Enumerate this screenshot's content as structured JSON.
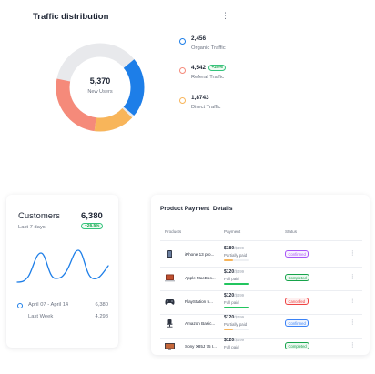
{
  "traffic": {
    "title": "Traffic distribution",
    "menu_icon": "kebab-vertical-icon",
    "total": "5,370",
    "total_label": "New Users",
    "legend": [
      {
        "value": "2,456",
        "badge": "",
        "label": "Organic Traffic",
        "color": "#1d7ee8"
      },
      {
        "value": "4,542",
        "badge": "+25%",
        "label": "Referal Traffic",
        "color": "#f58a7a"
      },
      {
        "value": "1,8743",
        "badge": "",
        "label": "Direct Traffic",
        "color": "#f8b55a"
      }
    ],
    "colors": {
      "organic": "#1d7ee8",
      "referral": "#f58a7a",
      "direct": "#f8b55a",
      "rest": "#e8e9ec"
    }
  },
  "customers": {
    "title": "Customers",
    "total": "6,380",
    "period": "Last 7 days",
    "badge": "+26.5%",
    "rows": [
      {
        "label": "April 07 - April 14",
        "value": "6,380"
      },
      {
        "label": "Last Week",
        "value": "4,298"
      }
    ],
    "line_color": "#1d7ee8"
  },
  "payment": {
    "title": "Product Payment  Details",
    "headers": {
      "products": "Products",
      "payment": "Payment",
      "status": "Status"
    },
    "rows": [
      {
        "product": "iPhone 13 pro...",
        "price": "$180",
        "strike": "/$499",
        "state": "Partially paid",
        "progress": 0.35,
        "bar_color": "#f8b55a",
        "status": "Confirmed",
        "status_color": "#a855f7",
        "icon": "phone-icon"
      },
      {
        "product": "Apple MacBoo...",
        "price": "$120",
        "strike": "/$499",
        "state": "Full paid",
        "progress": 1.0,
        "bar_color": "#22c55e",
        "status": "Completed",
        "status_color": "#16a34a",
        "icon": "laptop-icon"
      },
      {
        "product": "PlayStation 5...",
        "price": "$120",
        "strike": "/$499",
        "state": "Full paid",
        "progress": 1.0,
        "bar_color": "#22c55e",
        "status": "Cancelled",
        "status_color": "#ef4444",
        "icon": "gamepad-icon"
      },
      {
        "product": "Amazon Basic...",
        "price": "$120",
        "strike": "/$499",
        "state": "Partially paid",
        "progress": 0.35,
        "bar_color": "#f8b55a",
        "status": "Confirmed",
        "status_color": "#3b82f6",
        "icon": "office-chair-icon"
      },
      {
        "product": "Sony X85J 75 I...",
        "price": "$120",
        "strike": "/$499",
        "state": "Full paid",
        "progress": 1.0,
        "bar_color": "#22c55e",
        "status": "Completed",
        "status_color": "#16a34a",
        "icon": "tv-icon"
      }
    ]
  }
}
